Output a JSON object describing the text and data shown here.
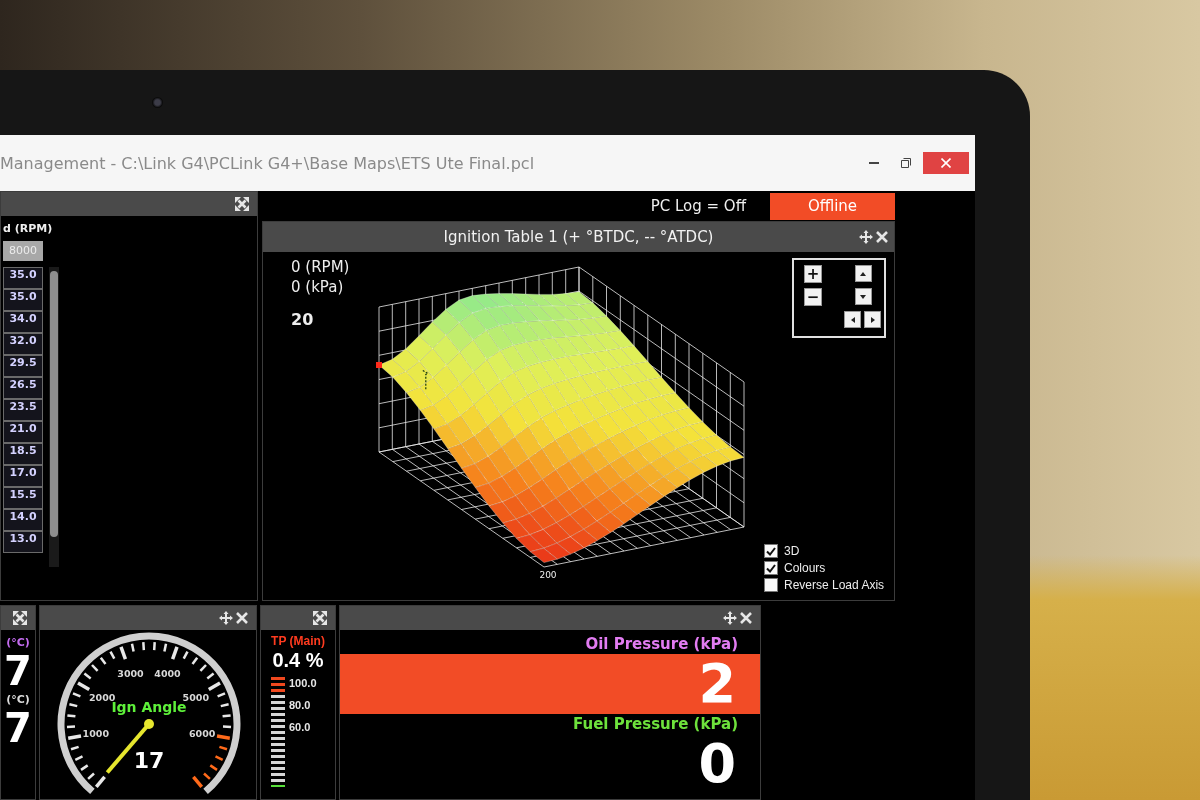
{
  "window": {
    "title": "Management - C:\\Link G4\\PCLink G4+\\Base Maps\\ETS Ute Final.pcl"
  },
  "status_bar": {
    "log_status": "PC Log = Off",
    "connection": {
      "label": "Offline",
      "online": false
    }
  },
  "table_panel": {
    "axis_label": "d (RPM)",
    "column_header": "8000",
    "cells": [
      "35.0",
      "35.0",
      "34.0",
      "32.0",
      "29.5",
      "26.5",
      "23.5",
      "21.0",
      "18.5",
      "17.0",
      "15.5",
      "14.0",
      "13.0"
    ]
  },
  "ignition_panel": {
    "title": "Ignition Table 1 (+ °BTDC, -- °ATDC)",
    "readouts": [
      {
        "kind": "axis",
        "text": "0 (RPM)"
      },
      {
        "kind": "axis",
        "text": "0 (kPa)"
      },
      {
        "kind": "value",
        "text": "20"
      }
    ],
    "zoom_buttons": [
      "+",
      "−"
    ],
    "surface_plot": {
      "corner_label": "200"
    },
    "options": [
      {
        "label": "3D",
        "checked": true
      },
      {
        "label": "Colours",
        "checked": true
      },
      {
        "label": "Reverse Load Axis",
        "checked": false
      }
    ]
  },
  "temperature_panel": {
    "readings": [
      {
        "label": "(°C)",
        "value": "7",
        "color": "#c46cf0"
      },
      {
        "label": "(°C)",
        "value": "7",
        "color": "#dcdcdc"
      }
    ]
  },
  "ign_angle_gauge": {
    "title": "Ign Angle",
    "value": "17",
    "scale_labels": [
      "1000",
      "2000",
      "3000",
      "4000",
      "5000",
      "6000"
    ]
  },
  "throttle_panel": {
    "label": "TP (Main)",
    "value": "0.4 %",
    "scale_labels": [
      "100.0",
      "80.0",
      "60.0"
    ],
    "level": 0.004
  },
  "pressure_panel": {
    "displays": [
      {
        "label": "Oil Pressure (kPa)",
        "value": "2",
        "color": "#e27cf2",
        "alarm": true
      },
      {
        "label": "Fuel Pressure (kPa)",
        "value": "0",
        "color": "#6ee23c",
        "alarm": false
      }
    ]
  }
}
